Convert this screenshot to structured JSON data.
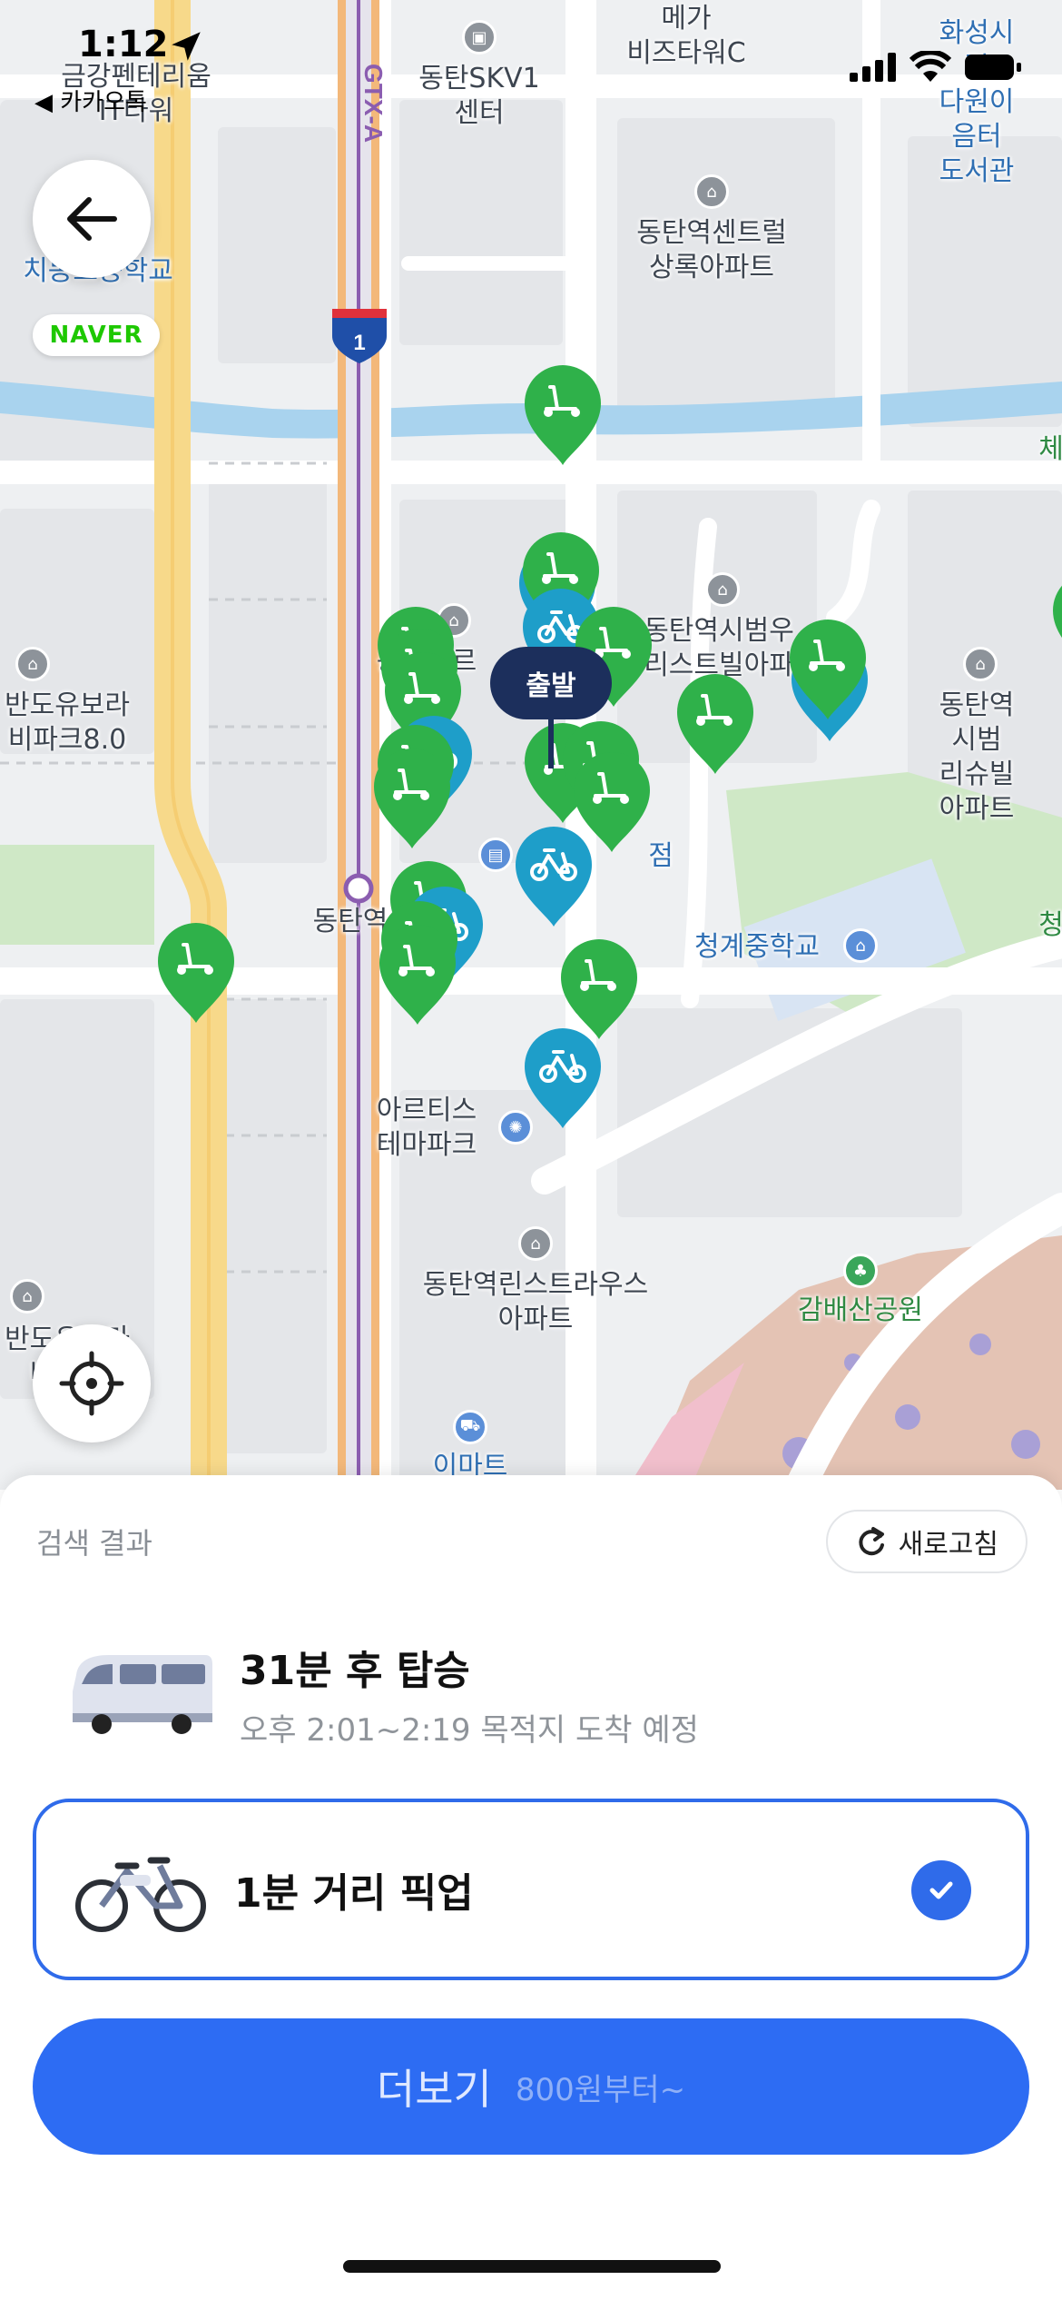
{
  "status_bar": {
    "time": "1:12",
    "back_app": "◀ 카카오톡"
  },
  "map": {
    "labels": {
      "kumkang": "금강펜테리움\nIT타워",
      "skv1": "동탄SKV1\n센터",
      "mega": "메가\n비즈타워C",
      "library": "화성시립\n다원이음터\n도서관",
      "chidong": "치동초등학교",
      "central": "동탄역센트럴\n상록아파트",
      "eastcut": "체",
      "bumwoo": "동탄역시범우\n리스트빌아파",
      "bando": "반도유보라\n비파크8.0",
      "richville": "동탄역시범\n리슈빌아파트",
      "station": "동탄역",
      "cheonggye": "청계중학교",
      "cheong2": "청",
      "artis": "아르티스\n테마파크",
      "riches": "동탄역린스트라우스\n아파트",
      "gambae": "감배산공원",
      "bando2": "반도유보라\n비파크",
      "emart": "이마트",
      "foru": "동탄포르\n테",
      "shop": "점",
      "gtx": "GTX-A",
      "line1": "1"
    },
    "naver_badge": "NAVER",
    "start_tag": "출발",
    "icons": {
      "back": "arrow-left-icon",
      "locate": "crosshair-icon",
      "pin_green": "green-scooter-pin-icon",
      "pin_blue": "blue-bike-pin-icon"
    }
  },
  "sheet": {
    "title": "검색 결과",
    "refresh_label": "새로고침",
    "shuttle": {
      "title": "31분 후 탑승",
      "subtitle": "오후 2:01~2:19 목적지 도착 예정"
    },
    "bike": {
      "title": "1분 거리 픽업",
      "selected": true
    },
    "more_button": {
      "label": "더보기",
      "sub": "800원부터~"
    }
  },
  "colors": {
    "accent": "#2f6bea",
    "pin_green": "#2fb14a",
    "pin_blue": "#1e9ec9",
    "start_tag": "#1c2f5c"
  }
}
